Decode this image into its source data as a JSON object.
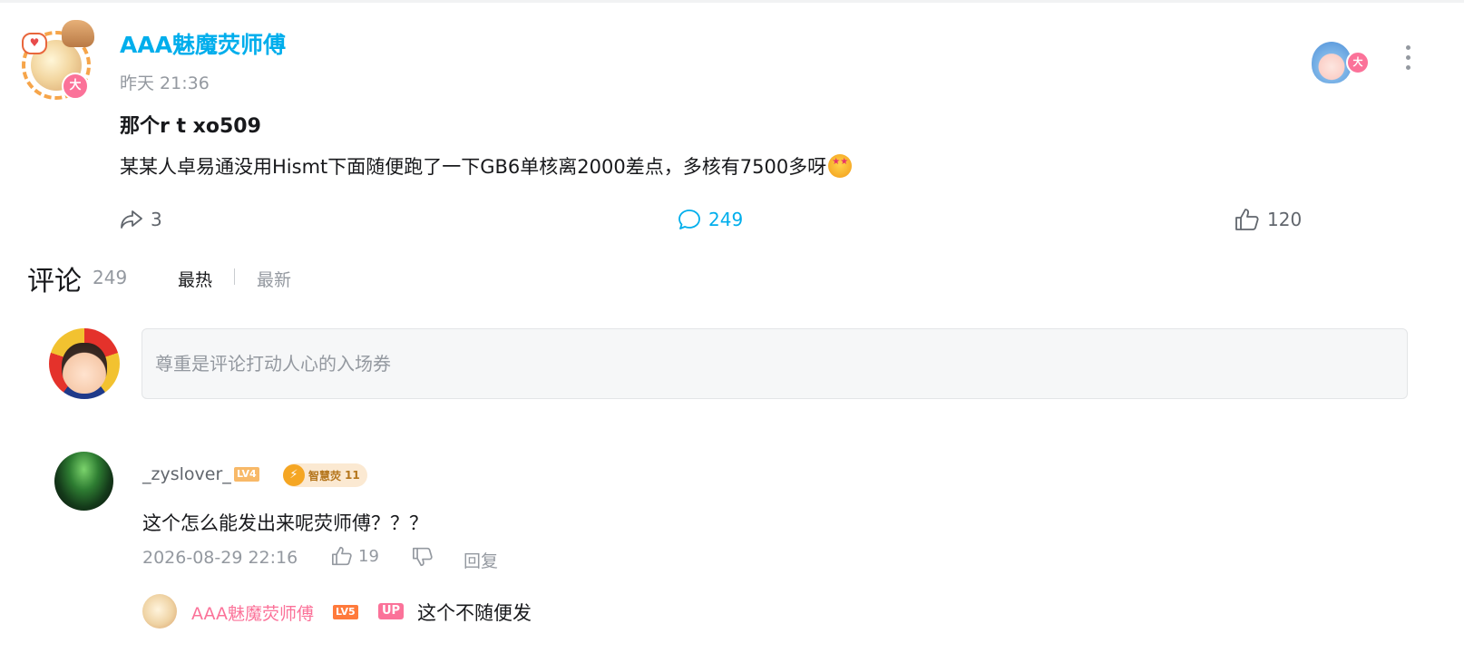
{
  "post": {
    "author": "AAA魅魔荧师傅",
    "time": "昨天 21:36",
    "title": "那个r t xo509",
    "body": "某某人卓易通没用Hismt下面随便跑了一下GB6单核离2000差点，多核有7500多呀",
    "badge": "大",
    "heart_icon": "heart-icon"
  },
  "actions": {
    "share_count": "3",
    "comment_count": "249",
    "like_count": "120"
  },
  "comments_header": {
    "title": "评论",
    "count": "249",
    "sort_hot": "最热",
    "sort_new": "最新"
  },
  "comment_input": {
    "placeholder": "尊重是评论打动人心的入场券"
  },
  "comments": [
    {
      "user": "_zyslover_",
      "level": "LV4",
      "medal_name": "智慧荧",
      "medal_level": "11",
      "text": "这个怎么能发出来呢荧师傅？？？",
      "time": "2026-08-29 22:16",
      "likes": "19",
      "reply_label": "回复",
      "replies": [
        {
          "user": "AAA魅魔荧师傅",
          "level": "LV5",
          "up_badge": "UP",
          "text": "这个不随便发"
        }
      ]
    }
  ],
  "colors": {
    "accent_blue": "#00aeec",
    "pink": "#fb7299",
    "text_gray": "#9499a0"
  }
}
